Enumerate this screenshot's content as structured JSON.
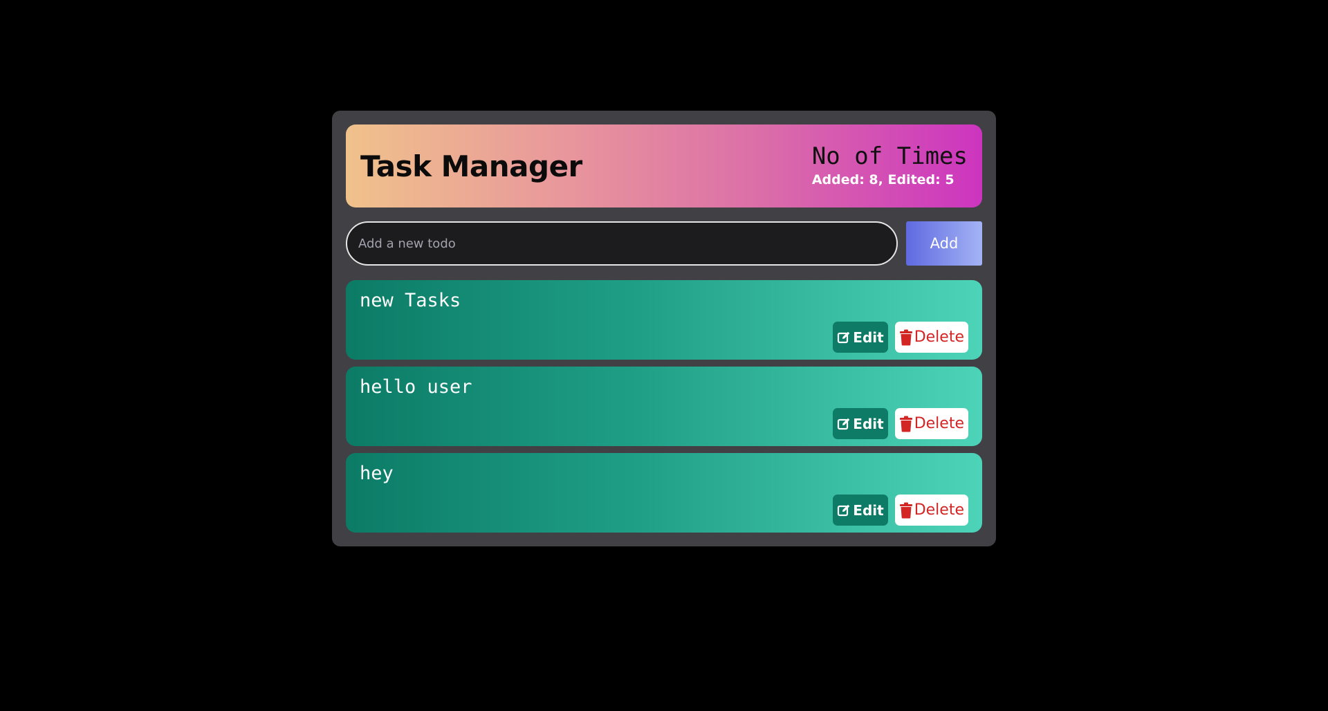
{
  "header": {
    "title": "Task Manager",
    "stats_title": "No of Times",
    "stats_counts": "Added: 8, Edited: 5"
  },
  "input": {
    "placeholder": "Add a new todo",
    "value": ""
  },
  "add_button_label": "Add",
  "todos": [
    {
      "text": "new Tasks",
      "edit_label": "Edit",
      "delete_label": "Delete"
    },
    {
      "text": "hello user",
      "edit_label": "Edit",
      "delete_label": "Delete"
    },
    {
      "text": "hey",
      "edit_label": "Edit",
      "delete_label": "Delete"
    }
  ],
  "icons": {
    "edit": "edit-icon",
    "delete": "trash-icon"
  },
  "colors": {
    "page_bg": "#000000",
    "panel_bg": "#414145",
    "card_start": "#0c7b66",
    "card_end": "#4dd4b8",
    "delete_red": "#d42525",
    "add_button_start": "#5f6ae0"
  }
}
